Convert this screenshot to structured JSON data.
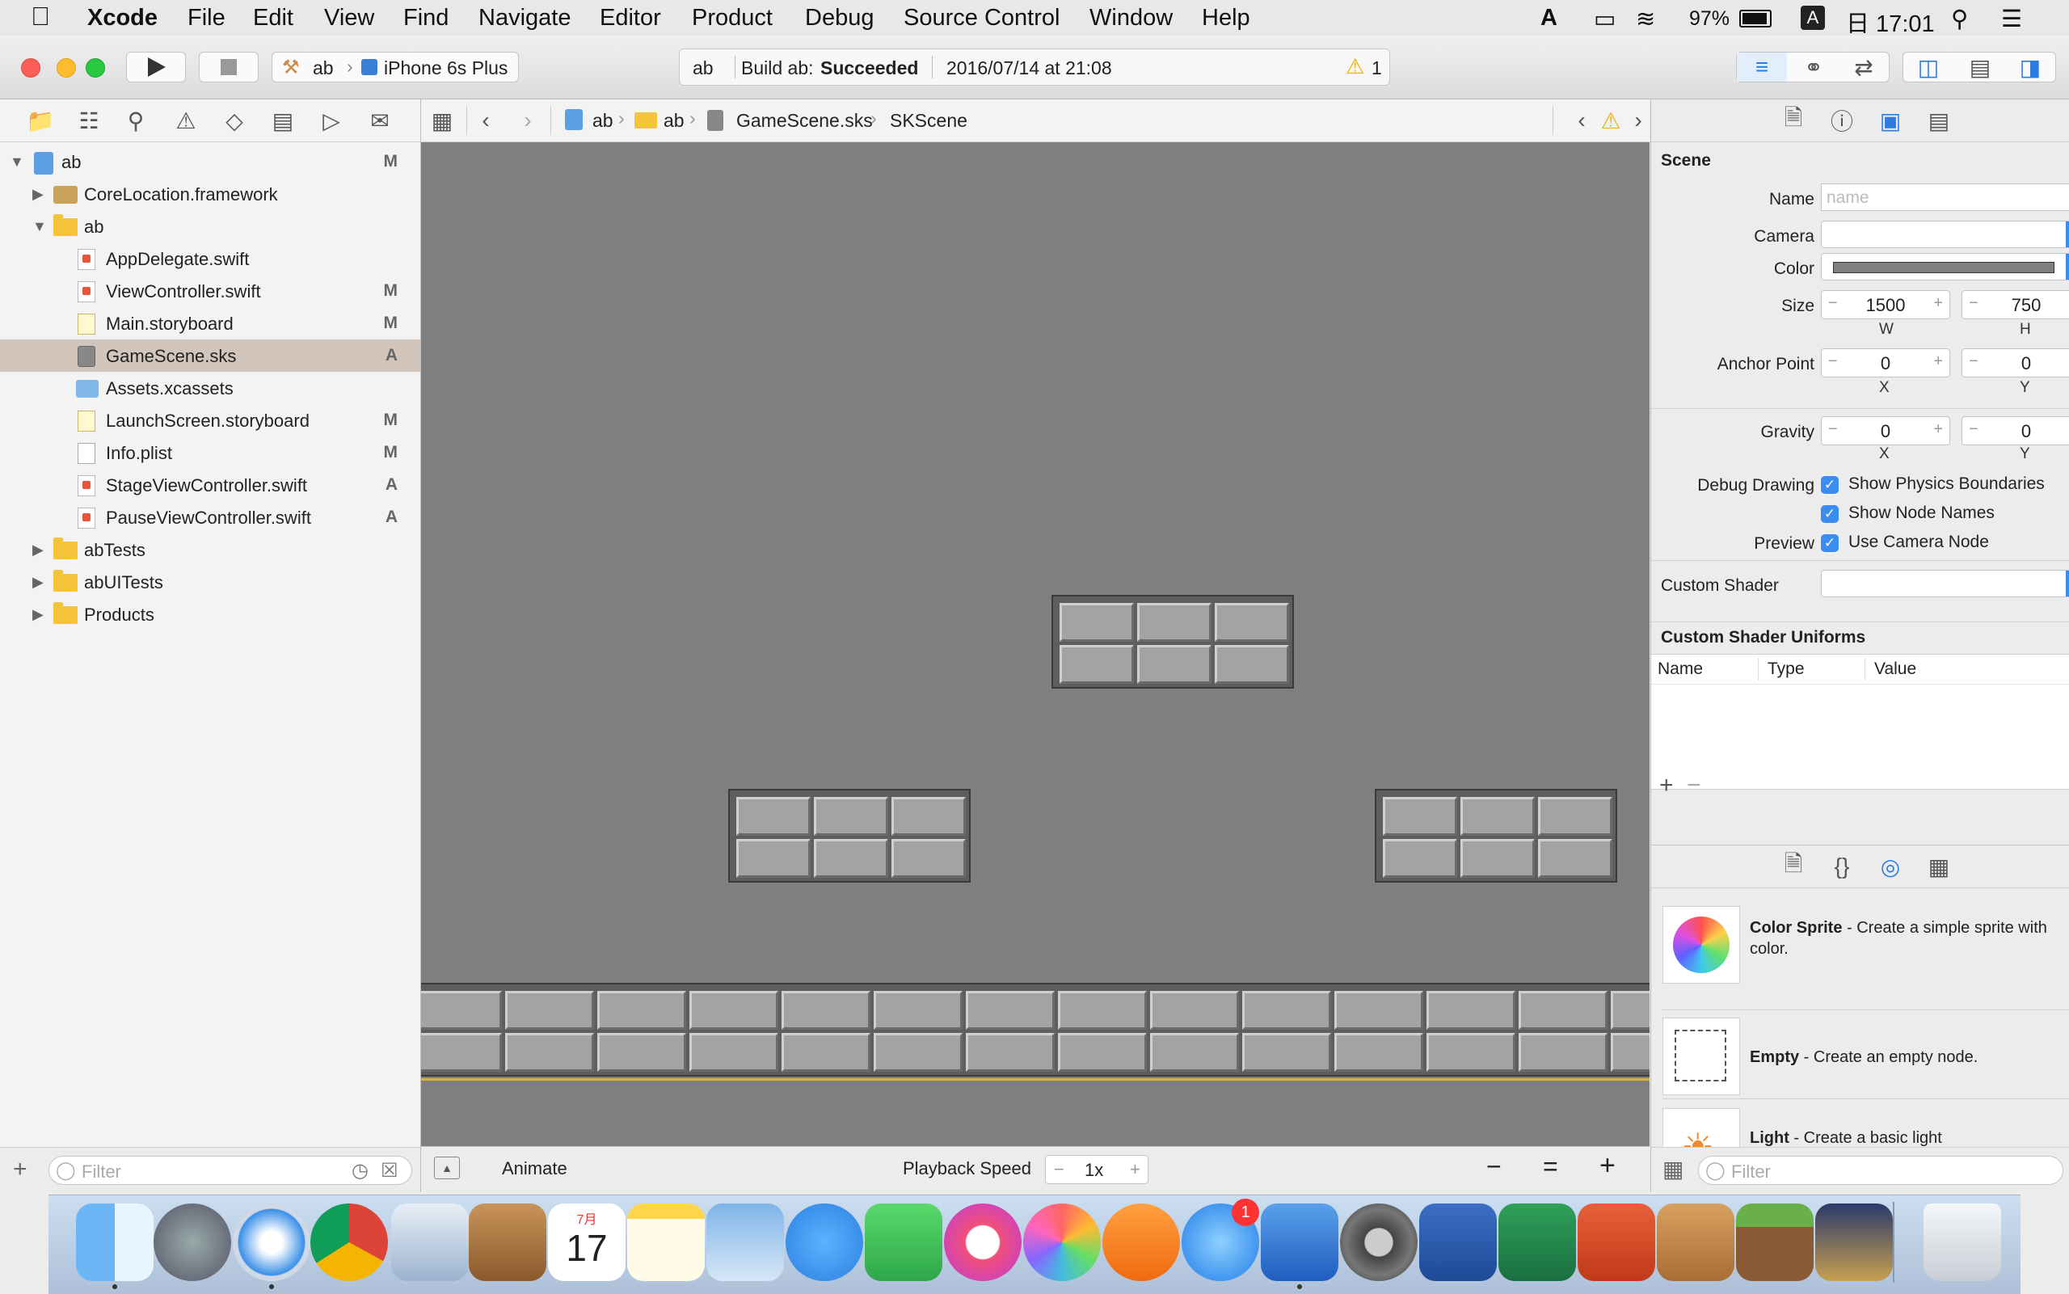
{
  "menubar": {
    "apple": "",
    "app": "Xcode",
    "items": [
      "File",
      "Edit",
      "View",
      "Find",
      "Navigate",
      "Editor",
      "Product",
      "Debug",
      "Source Control",
      "Window",
      "Help"
    ],
    "battery": "97%",
    "input_source": "A",
    "clock": "日 17:01"
  },
  "toolbar": {
    "scheme": "ab",
    "device": "iPhone 6s Plus",
    "status_project": "ab",
    "status_prefix": "Build ab: ",
    "status_result": "Succeeded",
    "status_time": "2016/07/14 at 21:08",
    "warning_count": "1"
  },
  "navigator": {
    "rows": [
      {
        "label": "ab",
        "status": "M"
      },
      {
        "label": "CoreLocation.framework",
        "status": ""
      },
      {
        "label": "ab",
        "status": ""
      },
      {
        "label": "AppDelegate.swift",
        "status": ""
      },
      {
        "label": "ViewController.swift",
        "status": "M"
      },
      {
        "label": "Main.storyboard",
        "status": "M"
      },
      {
        "label": "GameScene.sks",
        "status": "A"
      },
      {
        "label": "Assets.xcassets",
        "status": ""
      },
      {
        "label": "LaunchScreen.storyboard",
        "status": "M"
      },
      {
        "label": "Info.plist",
        "status": "M"
      },
      {
        "label": "StageViewController.swift",
        "status": "A"
      },
      {
        "label": "PauseViewController.swift",
        "status": "A"
      },
      {
        "label": "abTests",
        "status": ""
      },
      {
        "label": "abUITests",
        "status": ""
      },
      {
        "label": "Products",
        "status": ""
      }
    ],
    "filter_placeholder": "Filter"
  },
  "jumpbar": {
    "crumbs": [
      "ab",
      "ab",
      "GameScene.sks",
      "SKScene"
    ]
  },
  "editor_bottom": {
    "animate": "Animate",
    "playback_label": "Playback Speed",
    "speed": "1x"
  },
  "inspector": {
    "section": "Scene",
    "name_label": "Name",
    "name_placeholder": "name",
    "camera_label": "Camera",
    "color_label": "Color",
    "size_label": "Size",
    "size_w": "1500",
    "size_h": "750",
    "w": "W",
    "h": "H",
    "anchor_label": "Anchor Point",
    "anchor_x": "0",
    "anchor_y": "0",
    "x": "X",
    "y": "Y",
    "gravity_label": "Gravity",
    "gravity_x": "0",
    "gravity_y": "0",
    "debug_label": "Debug Drawing",
    "show_physics": "Show Physics Boundaries",
    "show_nodes": "Show Node Names",
    "preview_label": "Preview",
    "use_camera": "Use Camera Node",
    "shader_label": "Custom Shader",
    "uniforms_title": "Custom Shader Uniforms",
    "col_name": "Name",
    "col_type": "Type",
    "col_value": "Value",
    "library": [
      {
        "title": "Color Sprite",
        "desc": " - Create a simple sprite with color."
      },
      {
        "title": "Empty",
        "desc": " - Create an empty node."
      },
      {
        "title": "Light",
        "desc": " - Create a basic light"
      }
    ],
    "filter_placeholder": "Filter"
  },
  "dock": {
    "calendar_month": "7月",
    "calendar_day": "17",
    "appstore_badge": "1"
  }
}
